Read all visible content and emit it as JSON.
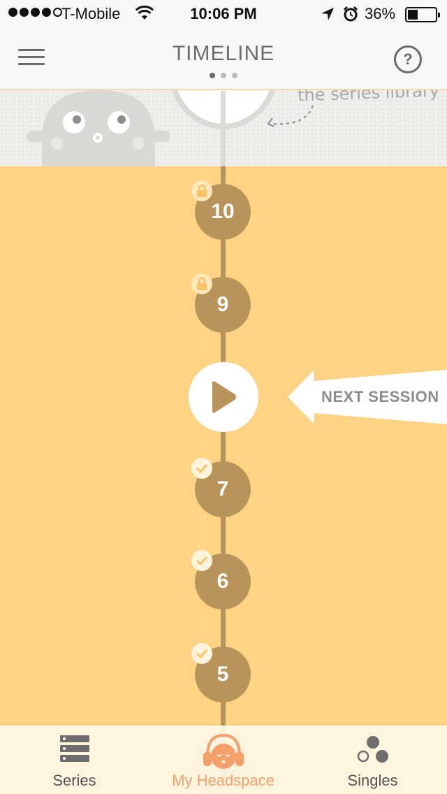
{
  "status_bar": {
    "carrier": "T-Mobile",
    "time": "10:06 PM",
    "battery_percent": "36%",
    "battery_level": 0.36,
    "signal_bars": 4
  },
  "nav": {
    "title": "TIMELINE",
    "page_count": 3,
    "active_page": 1,
    "help_label": "?"
  },
  "hint": {
    "text": "the series library"
  },
  "sessions": [
    {
      "number": "10",
      "status": "locked"
    },
    {
      "number": "9",
      "status": "locked"
    },
    {
      "number": "",
      "status": "next"
    },
    {
      "number": "7",
      "status": "completed"
    },
    {
      "number": "6",
      "status": "completed"
    },
    {
      "number": "5",
      "status": "completed"
    }
  ],
  "next_session": {
    "label": "NEXT SESSION"
  },
  "tabs": [
    {
      "label": "Series",
      "icon": "series-icon",
      "active": false
    },
    {
      "label": "My Headspace",
      "icon": "headspace-face-icon",
      "active": true
    },
    {
      "label": "Singles",
      "icon": "singles-icon",
      "active": false
    }
  ],
  "colors": {
    "background": "#FFD384",
    "session_node": "#B8945A",
    "active_tab": "#F5A06B",
    "nav_text": "#6B6B6B"
  }
}
